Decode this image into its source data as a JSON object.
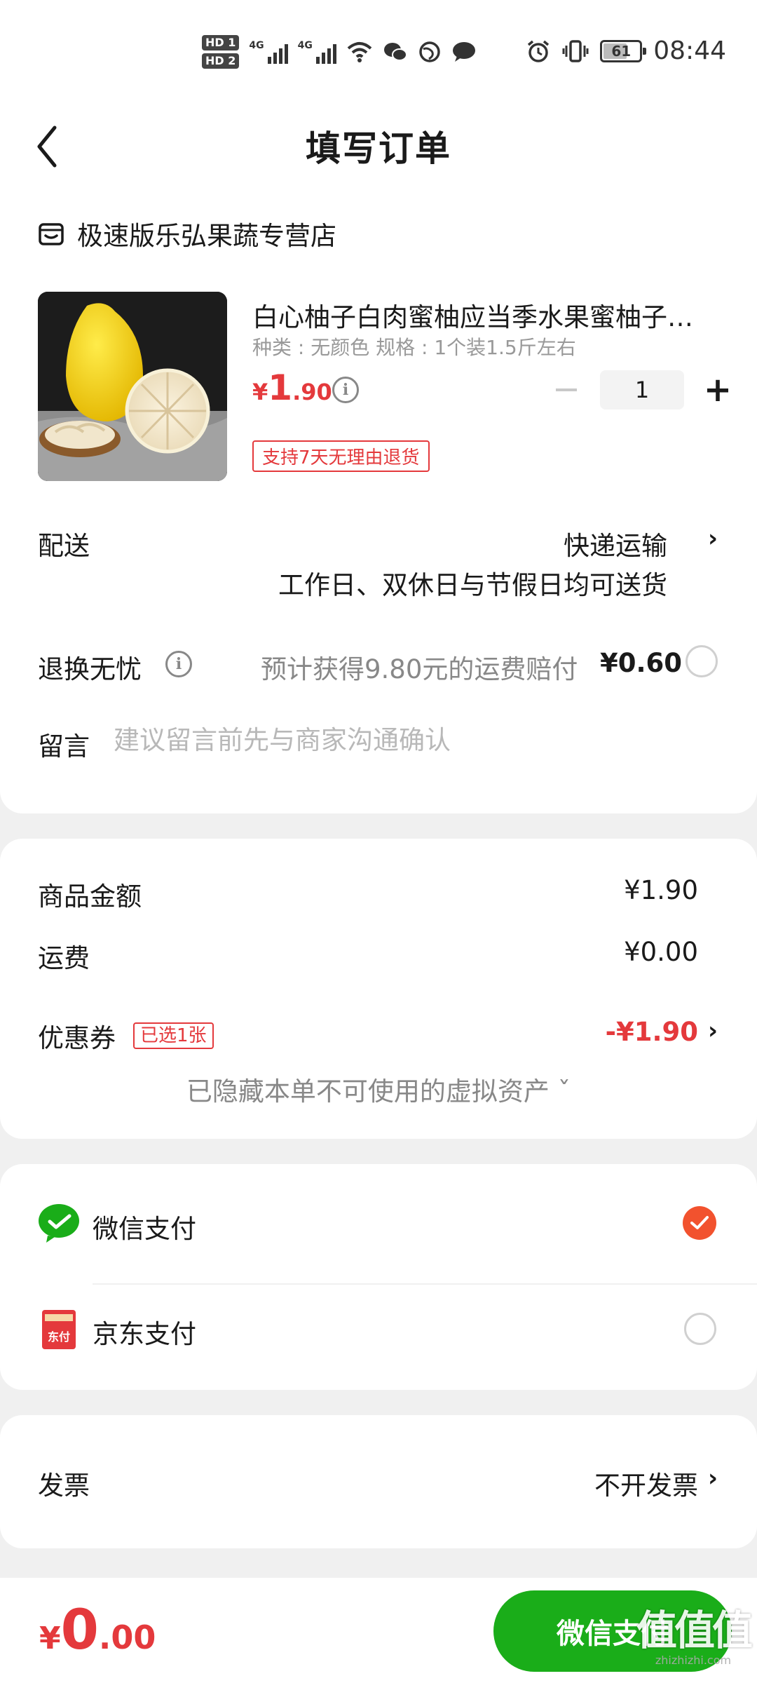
{
  "status_bar": {
    "hd1": "HD 1",
    "hd2": "HD 2",
    "net1": "4G",
    "net2": "4G",
    "battery": "61",
    "time": "08:44",
    "icons": [
      "wifi-icon",
      "wechat-icon",
      "browser-icon",
      "message-icon",
      "alarm-icon",
      "vibrate-icon"
    ]
  },
  "header": {
    "title": "填写订单",
    "back_icon": "chevron-left-icon"
  },
  "shop": {
    "name": "极速版乐弘果蔬专营店",
    "icon": "store-icon"
  },
  "product": {
    "title": "白心柚子白肉蜜柚应当季水果蜜柚子新鲜",
    "spec": "种类 : 无颜色    规格 : 1个装1.5斤左右",
    "price_currency": "¥",
    "price_integer": "1",
    "price_decimal": ".90",
    "quantity": "1",
    "return_tag": "支持7天无理由退货"
  },
  "delivery": {
    "label": "配送",
    "value": "快递运输",
    "sub": "工作日、双休日与节假日均可送货"
  },
  "worry_free": {
    "label": "退换无忧",
    "desc": "预计获得9.80元的运费赔付",
    "price": "¥0.60",
    "selected": false
  },
  "note": {
    "label": "留言",
    "placeholder": "建议留言前先与商家沟通确认",
    "value": ""
  },
  "summary": {
    "goods_label": "商品金额",
    "goods_value": "¥1.90",
    "shipping_label": "运费",
    "shipping_value": "¥0.00",
    "coupon_label": "优惠券",
    "coupon_tag": "已选1张",
    "coupon_value": "-¥1.90",
    "hidden_assets": "已隐藏本单不可使用的虚拟资产 ˇ"
  },
  "payment": {
    "methods": [
      {
        "label": "微信支付",
        "icon": "wechat-pay-icon",
        "selected": true
      },
      {
        "label": "京东支付",
        "icon": "jd-pay-icon",
        "icon_text": "东付",
        "selected": false
      }
    ]
  },
  "invoice": {
    "label": "发票",
    "value": "不开发票"
  },
  "bottom": {
    "currency": "¥",
    "total_integer": "0",
    "total_decimal": ".00",
    "pay_button": "微信支付",
    "watermark": "值值值",
    "watermark_sub": "zhizhizhi.com"
  },
  "colors": {
    "accent_red": "#e4393c",
    "wechat_green": "#1aad19",
    "check_orange": "#f2522e",
    "background": "#f0f0f0"
  }
}
